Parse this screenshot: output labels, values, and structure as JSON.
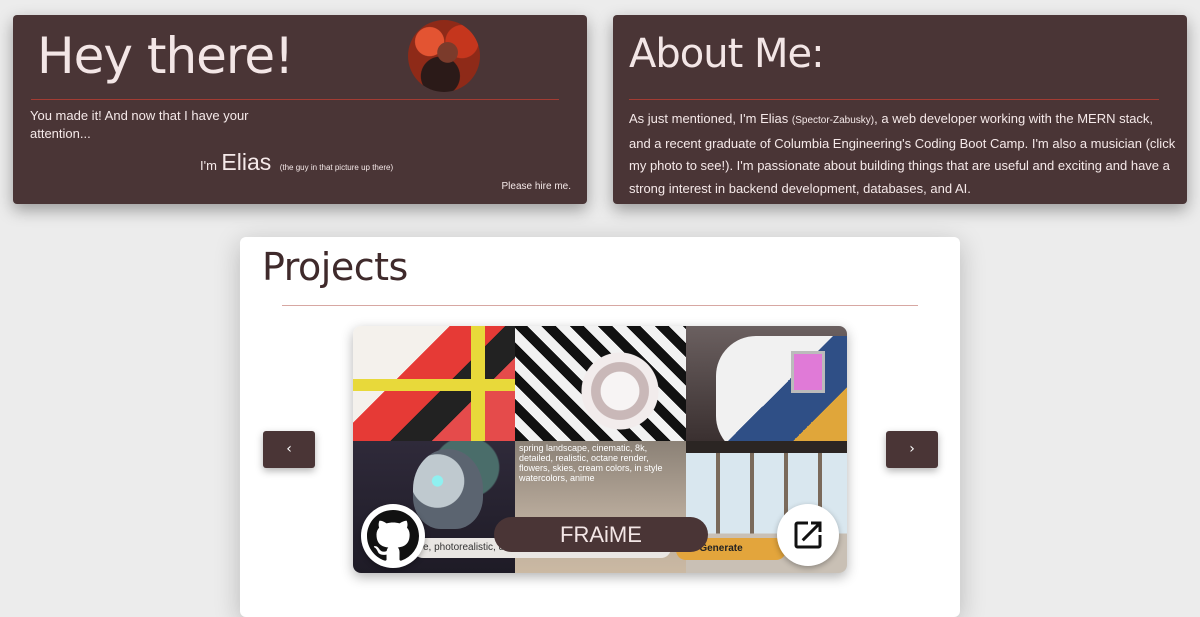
{
  "intro": {
    "title": "Hey there!",
    "body": "You made it! And now that I have your attention...",
    "im": "I'm",
    "name": "Elias",
    "aside": "(the guy in that picture up there)",
    "hire": "Please hire me."
  },
  "about": {
    "title": "About Me:",
    "text_before": "As just mentioned, I'm Elias ",
    "surname": "(Spector-Zabusky)",
    "text_after": ", a web developer working with the MERN stack, and a recent graduate of Columbia Engineering's Coding Boot Camp. I'm also a musician (click my photo to see!). I'm passionate about building things that are useful and exciting and have a strong interest in backend development, databases, and AI."
  },
  "projects": {
    "title": "Projects",
    "prev_label": "‹",
    "next_label": "›",
    "current": {
      "name": "FRAiME",
      "preview_prompt": "spring landscape, cinematic, 8k, detailed, realistic, octane render, flowers, skies, cream colors, in style watercolors, anime",
      "input_text": "e, photorealistic, 8k, birds, turquoise color palette",
      "generate_label": "Generate"
    },
    "icons": {
      "github": "github-icon",
      "external": "external-link-icon"
    }
  },
  "colors": {
    "card": "#4a3536",
    "accent_rule": "#a33c33",
    "generate": "#e3a53c"
  }
}
